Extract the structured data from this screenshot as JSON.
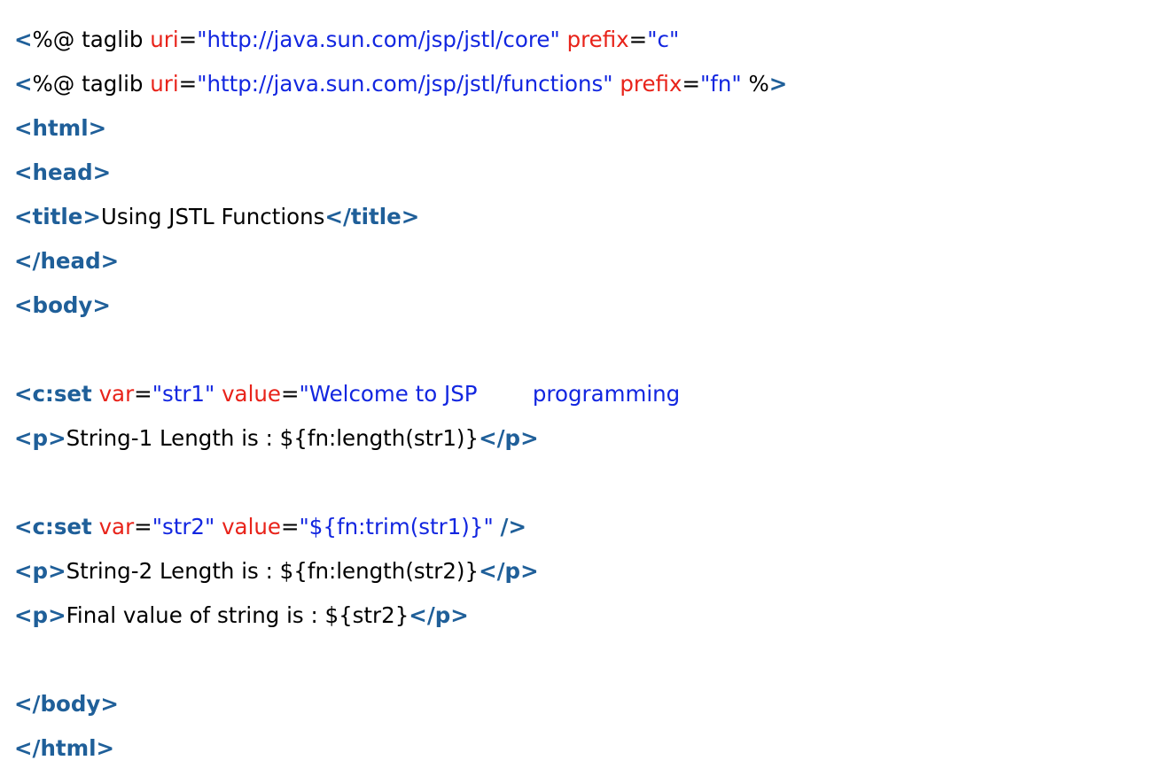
{
  "code": {
    "lines": [
      [
        {
          "t": "<",
          "c": "tag"
        },
        {
          "t": "%@ taglib ",
          "c": "txt"
        },
        {
          "t": "uri",
          "c": "attr"
        },
        {
          "t": "=",
          "c": "txt"
        },
        {
          "t": "\"http://java.sun.com/jsp/jstl/core\"",
          "c": "val"
        },
        {
          "t": " ",
          "c": "txt"
        },
        {
          "t": "prefix",
          "c": "attr"
        },
        {
          "t": "=",
          "c": "txt"
        },
        {
          "t": "\"c\"",
          "c": "val"
        }
      ],
      [
        {
          "t": "<",
          "c": "tag"
        },
        {
          "t": "%@ taglib ",
          "c": "txt"
        },
        {
          "t": "uri",
          "c": "attr"
        },
        {
          "t": "=",
          "c": "txt"
        },
        {
          "t": "\"http://java.sun.com/jsp/jstl/functions\"",
          "c": "val"
        },
        {
          "t": " ",
          "c": "txt"
        },
        {
          "t": "prefix",
          "c": "attr"
        },
        {
          "t": "=",
          "c": "txt"
        },
        {
          "t": "\"fn\"",
          "c": "val"
        },
        {
          "t": " %",
          "c": "txt"
        },
        {
          "t": ">",
          "c": "tag"
        }
      ],
      [
        {
          "t": "<html>",
          "c": "tag"
        }
      ],
      [
        {
          "t": "<head>",
          "c": "tag"
        }
      ],
      [
        {
          "t": "<title>",
          "c": "tag"
        },
        {
          "t": "Using JSTL Functions",
          "c": "txt"
        },
        {
          "t": "</title>",
          "c": "tag"
        }
      ],
      [
        {
          "t": "</head>",
          "c": "tag"
        }
      ],
      [
        {
          "t": "<body>",
          "c": "tag"
        }
      ],
      [],
      [
        {
          "t": "<c:set",
          "c": "tag"
        },
        {
          "t": " ",
          "c": "txt"
        },
        {
          "t": "var",
          "c": "attr"
        },
        {
          "t": "=",
          "c": "txt"
        },
        {
          "t": "\"str1\"",
          "c": "val"
        },
        {
          "t": " ",
          "c": "txt"
        },
        {
          "t": "value",
          "c": "attr"
        },
        {
          "t": "=",
          "c": "txt"
        },
        {
          "t": "\"Welcome to JSP        programming",
          "c": "val"
        }
      ],
      [
        {
          "t": "<p>",
          "c": "tag"
        },
        {
          "t": "String-1 Length is : ${fn:length(str1)}",
          "c": "txt"
        },
        {
          "t": "</p>",
          "c": "tag"
        }
      ],
      [],
      [
        {
          "t": "<c:set",
          "c": "tag"
        },
        {
          "t": " ",
          "c": "txt"
        },
        {
          "t": "var",
          "c": "attr"
        },
        {
          "t": "=",
          "c": "txt"
        },
        {
          "t": "\"str2\"",
          "c": "val"
        },
        {
          "t": " ",
          "c": "txt"
        },
        {
          "t": "value",
          "c": "attr"
        },
        {
          "t": "=",
          "c": "txt"
        },
        {
          "t": "\"${fn:trim(str1)}\"",
          "c": "val"
        },
        {
          "t": " ",
          "c": "txt"
        },
        {
          "t": "/>",
          "c": "tag"
        }
      ],
      [
        {
          "t": "<p>",
          "c": "tag"
        },
        {
          "t": "String-2 Length is : ${fn:length(str2)}",
          "c": "txt"
        },
        {
          "t": "</p>",
          "c": "tag"
        }
      ],
      [
        {
          "t": "<p>",
          "c": "tag"
        },
        {
          "t": "Final value of string is : ${str2}",
          "c": "txt"
        },
        {
          "t": "</p>",
          "c": "tag"
        }
      ],
      [],
      [
        {
          "t": "</body>",
          "c": "tag"
        }
      ],
      [
        {
          "t": "</html>",
          "c": "tag"
        }
      ]
    ]
  }
}
